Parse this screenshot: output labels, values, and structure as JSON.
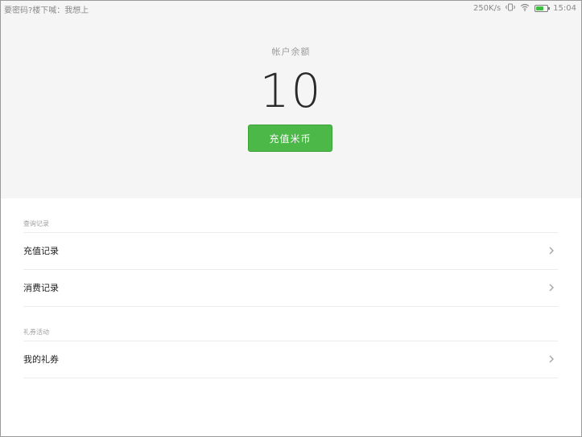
{
  "status_bar": {
    "left_text": "要密码?楼下喊：我想上",
    "net_speed": "250K/s",
    "time": "15:04",
    "icons": [
      "vibrate-icon",
      "wifi-icon",
      "battery-icon"
    ]
  },
  "balance": {
    "label": "帐户余额",
    "value": "10"
  },
  "recharge_button": {
    "label": "充值米币",
    "color": "#4cb848"
  },
  "sections": [
    {
      "header": "查询记录",
      "items": [
        {
          "label": "充值记录",
          "icon": "chevron-right-icon"
        },
        {
          "label": "消费记录",
          "icon": "chevron-right-icon"
        }
      ]
    },
    {
      "header": "礼券活动",
      "items": [
        {
          "label": "我的礼券",
          "icon": "chevron-right-icon"
        }
      ]
    }
  ],
  "colors": {
    "header_background": "#f4f5f4",
    "accent_green": "#4cb848",
    "battery_green": "#3fbf3f"
  }
}
